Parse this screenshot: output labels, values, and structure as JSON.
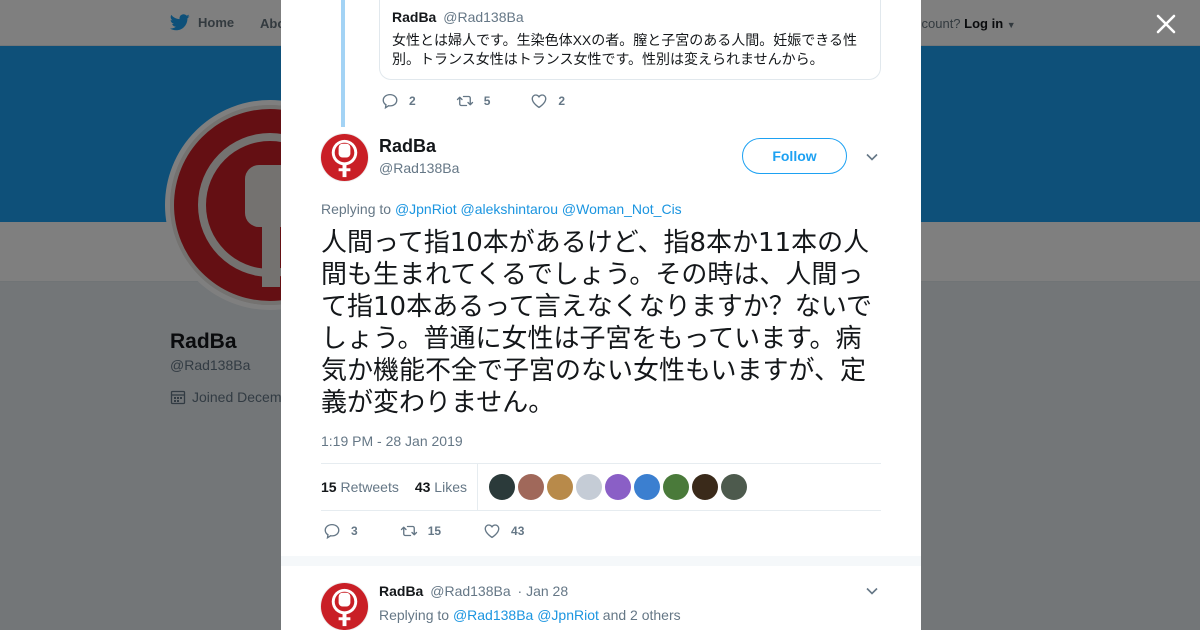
{
  "nav": {
    "home": "Home",
    "about": "Abo",
    "account_prompt": "ccount?",
    "login": "Log in"
  },
  "background_profile": {
    "name": "RadBa",
    "handle": "@Rad138Ba",
    "joined": "Joined Decem"
  },
  "colors": {
    "brand": "#1da1f2",
    "link": "#1b95e0",
    "avatar_red": "#c91f26",
    "thread_line": "#a3d3f5"
  },
  "quoted_tweet": {
    "name": "RadBa",
    "handle": "@Rad138Ba",
    "text": "女性とは婦人です。生染色体XXの者。膣と子宮のある人間。妊娠できる性別。トランス女性はトランス女性です。性別は変えられませんから。",
    "replies": "2",
    "retweets": "5",
    "likes": "2"
  },
  "main_tweet": {
    "name": "RadBa",
    "handle": "@Rad138Ba",
    "follow_label": "Follow",
    "replying_label": "Replying to",
    "replying_to": [
      "@JpnRiot",
      "@alekshintarou",
      "@Woman_Not_Cis"
    ],
    "text": "人間って指10本があるけど、指8本か11本の人間も生まれてくるでしょう。その時は、人間って指10本あるって言えなくなりますか？ないでしょう。普通に女性は子宮をもっています。病気か機能不全で子宮のない女性もいますが、定義が変わりません。",
    "timestamp": "1:19 PM - 28 Jan 2019",
    "retweets_count": "15",
    "retweets_label": "Retweets",
    "likes_count": "43",
    "likes_label": "Likes",
    "replies": "3",
    "retweets": "15",
    "likes": "43"
  },
  "liker_avatars": [
    "#2b3a3a",
    "#a0685a",
    "#b88a4a",
    "#c5ccd6",
    "#8a5fc6",
    "#3b7fd0",
    "#4a7a3a",
    "#3a2a1a",
    "#4d5a4d"
  ],
  "reply_tweet": {
    "name": "RadBa",
    "handle": "@Rad138Ba",
    "date": "· Jan 28",
    "replying_label": "Replying to",
    "replying_to": [
      "@Rad138Ba",
      "@JpnRiot"
    ],
    "and_others": "and 2 others"
  },
  "icons": {
    "bird": "twitter-bird-icon",
    "close": "close-icon",
    "reply": "reply-icon",
    "retweet": "retweet-icon",
    "like": "heart-icon",
    "caret": "chevron-down-icon",
    "calendar": "calendar-icon"
  }
}
